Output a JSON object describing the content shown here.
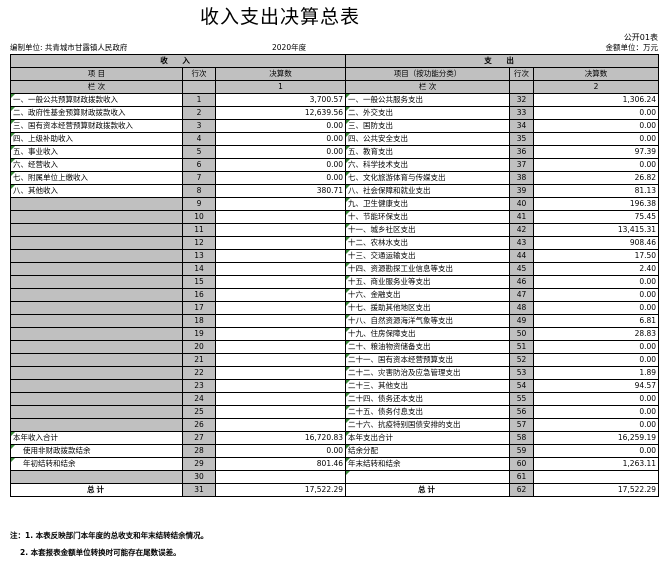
{
  "title": "收入支出决算总表",
  "form_code": "公开01表",
  "unit_label": "编制单位: 共青城市甘露镇人民政府",
  "year": "2020年度",
  "money_unit": "金额单位：万元",
  "header": {
    "income": "收 入",
    "expense": "支 出",
    "item": "项 目",
    "row_no": "行次",
    "amount": "决算数",
    "expense_item": "项目（按功能分类）",
    "column": "栏 次",
    "col1": "1",
    "col2": "2"
  },
  "rows": [
    [
      "一、一般公共预算财政拨款收入",
      "1",
      "3,700.57",
      "一、一般公共服务支出",
      "32",
      "1,306.24"
    ],
    [
      "二、政府性基金预算财政拨款收入",
      "2",
      "12,639.56",
      "二、外交支出",
      "33",
      "0.00"
    ],
    [
      "三、国有资本经营预算财政拨款收入",
      "3",
      "0.00",
      "三、国防支出",
      "34",
      "0.00"
    ],
    [
      "四、上级补助收入",
      "4",
      "0.00",
      "四、公共安全支出",
      "35",
      "0.00"
    ],
    [
      "五、事业收入",
      "5",
      "0.00",
      "五、教育支出",
      "36",
      "97.39"
    ],
    [
      "六、经营收入",
      "6",
      "0.00",
      "六、科学技术支出",
      "37",
      "0.00"
    ],
    [
      "七、附属单位上缴收入",
      "7",
      "0.00",
      "七、文化旅游体育与传媒支出",
      "38",
      "26.82"
    ],
    [
      "八、其他收入",
      "8",
      "380.71",
      "八、社会保障和就业支出",
      "39",
      "81.13"
    ],
    [
      "",
      "9",
      "",
      "九、卫生健康支出",
      "40",
      "196.38"
    ],
    [
      "",
      "10",
      "",
      "十、节能环保支出",
      "41",
      "75.45"
    ],
    [
      "",
      "11",
      "",
      "十一、城乡社区支出",
      "42",
      "13,415.31"
    ],
    [
      "",
      "12",
      "",
      "十二、农林水支出",
      "43",
      "908.46"
    ],
    [
      "",
      "13",
      "",
      "十三、交通运输支出",
      "44",
      "17.50"
    ],
    [
      "",
      "14",
      "",
      "十四、资源勘探工业信息等支出",
      "45",
      "2.40"
    ],
    [
      "",
      "15",
      "",
      "十五、商业服务业等支出",
      "46",
      "0.00"
    ],
    [
      "",
      "16",
      "",
      "十六、金融支出",
      "47",
      "0.00"
    ],
    [
      "",
      "17",
      "",
      "十七、援助其他地区支出",
      "48",
      "0.00"
    ],
    [
      "",
      "18",
      "",
      "十八、自然资源海洋气象等支出",
      "49",
      "6.81"
    ],
    [
      "",
      "19",
      "",
      "十九、住房保障支出",
      "50",
      "28.83"
    ],
    [
      "",
      "20",
      "",
      "二十、粮油物资储备支出",
      "51",
      "0.00"
    ],
    [
      "",
      "21",
      "",
      "二十一、国有资本经营预算支出",
      "52",
      "0.00"
    ],
    [
      "",
      "22",
      "",
      "二十二、灾害防治及应急管理支出",
      "53",
      "1.89"
    ],
    [
      "",
      "23",
      "",
      "二十三、其他支出",
      "54",
      "94.57"
    ],
    [
      "",
      "24",
      "",
      "二十四、债务还本支出",
      "55",
      "0.00"
    ],
    [
      "",
      "25",
      "",
      "二十五、债务付息支出",
      "56",
      "0.00"
    ],
    [
      "",
      "26",
      "",
      "二十六、抗疫特别国债安排的支出",
      "57",
      "0.00"
    ],
    [
      "本年收入合计",
      "27",
      "16,720.83",
      "本年支出合计",
      "58",
      "16,259.19"
    ],
    [
      "使用非财政拨款结余",
      "28",
      "0.00",
      "结余分配",
      "59",
      "0.00"
    ],
    [
      "年初结转和结余",
      "29",
      "801.46",
      "年末结转和结余",
      "60",
      "1,263.11"
    ],
    [
      "",
      "30",
      "",
      "",
      "61",
      ""
    ]
  ],
  "total": {
    "label": "总计",
    "income_row": "31",
    "income_amount": "17,522.29",
    "expense_label": "总计",
    "expense_row": "62",
    "expense_amount": "17,522.29"
  },
  "notes": [
    "注：1. 本表反映部门本年度的总收支和年末结转结余情况。",
    "2. 本套报表金额单位转换时可能存在尾数误差。"
  ]
}
